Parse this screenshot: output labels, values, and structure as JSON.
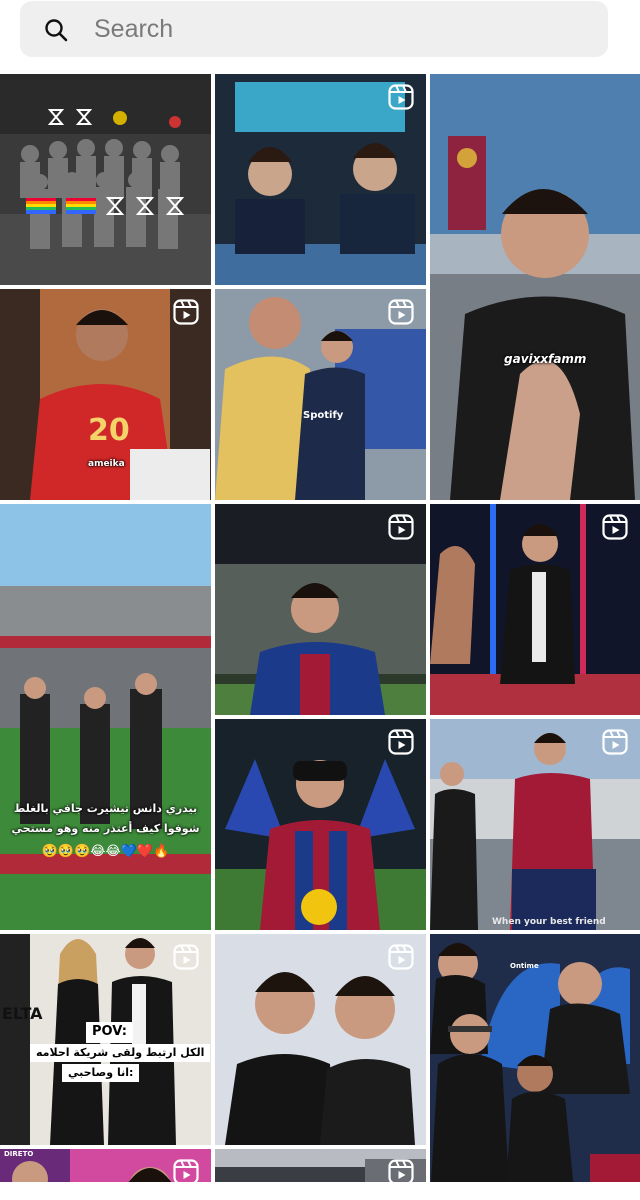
{
  "search": {
    "placeholder": "Search",
    "icon": "search-icon"
  },
  "tiles": [
    {
      "kind": "image",
      "reel": false,
      "description_icon": "team-photo"
    },
    {
      "kind": "reel",
      "reel": true
    },
    {
      "kind": "image",
      "reel": false,
      "watermark": "gavixxfamm"
    },
    {
      "kind": "reel",
      "reel": true,
      "jersey_number": "20",
      "sponsor": "ameika"
    },
    {
      "kind": "reel",
      "reel": true,
      "sponsor": "Spotify"
    },
    {
      "kind": "image",
      "reel": false
    },
    {
      "kind": "image",
      "reel": false,
      "caption_ar": "بيدري دانس تيشيرت جافي بالغلط",
      "caption_ar_2": "شوفوا كيف أعتذر منه وهو مستحي",
      "emojis": "🥹🥹🥹😂😂💙❤️🔥"
    },
    {
      "kind": "reel",
      "reel": true
    },
    {
      "kind": "reel",
      "reel": true
    },
    {
      "kind": "reel",
      "reel": true
    },
    {
      "kind": "reel",
      "reel": true,
      "caption": "When your best friend"
    },
    {
      "kind": "reel",
      "reel": true,
      "pov": "POV:",
      "caption_ar": "الكل ارتبط ولقى شريكة احلامه",
      "caption_ar_2": "انا وصاحبي:",
      "bg_text": "ELTA"
    },
    {
      "kind": "reel",
      "reel": true
    },
    {
      "kind": "image",
      "reel": false,
      "seat_text": "Ontime"
    },
    {
      "kind": "reel",
      "reel": true,
      "corner_text": "DIRETO"
    },
    {
      "kind": "reel",
      "reel": true
    },
    {
      "kind": "reel",
      "reel": true
    }
  ],
  "colors": {
    "search_bg": "#efefef",
    "text_placeholder": "#7a7a7a",
    "barca_blue": "#1b3a8a",
    "barca_red": "#a31a36"
  }
}
